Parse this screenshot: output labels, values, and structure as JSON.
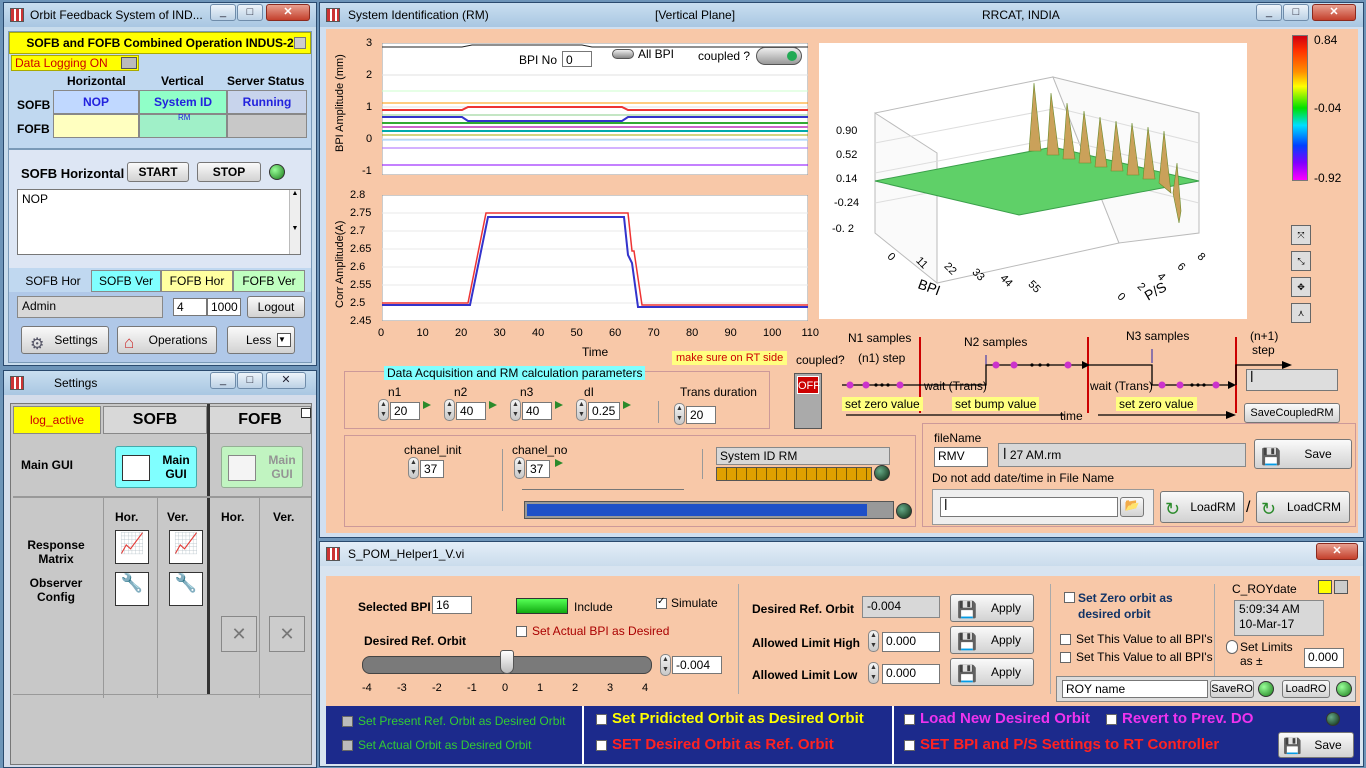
{
  "win1": {
    "title": "Orbit Feedback System of IND...",
    "header": "SOFB and FOFB Combined Operation INDUS-2",
    "data_logging": "Data Logging ON",
    "col_horizontal": "Horizontal",
    "col_vertical": "Vertical",
    "col_server": "Server Status",
    "row_sofb": "SOFB",
    "row_fofb": "FOFB",
    "sofb_h": "NOP",
    "sofb_v": "System ID",
    "sofb_v_sub": "RM",
    "sofb_status": "Running",
    "sofb_horizontal_label": "SOFB Horizontal",
    "start": "START",
    "stop": "STOP",
    "textbox": "NOP",
    "tabs": [
      "SOFB Hor",
      "SOFB Ver",
      "FOFB Hor",
      "FOFB Ver"
    ],
    "user": "Admin",
    "num1": "4",
    "num2": "1000",
    "logout": "Logout",
    "settings": "Settings",
    "operations": "Operations",
    "less": "Less"
  },
  "win2": {
    "title": "Settings",
    "log_active": "log_active",
    "sofb": "SOFB",
    "fofb": "FOFB",
    "main_gui_row": "Main GUI",
    "main_gui": "Main GUI",
    "hor": "Hor.",
    "ver": "Ver.",
    "resp": "Response Matrix",
    "obs": "Observer Config"
  },
  "win3": {
    "title": "System Identification (RM)",
    "subtitle": "[Vertical Plane]",
    "org": "RRCAT, INDIA",
    "bpi_no_label": "BPI No",
    "bpi_no": "0",
    "all_bpi": "All BPI",
    "coupled_q": "coupled ?",
    "chart1": {
      "ylabel": "BPI Amplitude (mm)",
      "yticks": [
        "3",
        "2",
        "1",
        "0",
        "-1"
      ]
    },
    "chart2": {
      "ylabel": "Corr Amplitude(A)",
      "xlabel": "Time",
      "yticks": [
        "2.8",
        "2.75",
        "2.7",
        "2.65",
        "2.6",
        "2.55",
        "2.5",
        "2.45"
      ],
      "xticks": [
        "0",
        "10",
        "20",
        "30",
        "40",
        "50",
        "60",
        "70",
        "80",
        "90",
        "100",
        "110"
      ]
    },
    "surface": {
      "zticks": [
        "0.90",
        "0.52",
        "0.14",
        "-0.24",
        "-0. 2"
      ],
      "bpi_ticks": [
        "0",
        "11",
        "22",
        "33",
        "44",
        "55"
      ],
      "ps_ticks": [
        "0",
        "2",
        "4",
        "6",
        "8"
      ],
      "bpi": "BPI",
      "ps": "P/S"
    },
    "colorbar": [
      "0.84",
      "-0.04",
      "-0.92"
    ],
    "params": {
      "title": "Data Acquisition and RM calculation parameters",
      "n1": "n1",
      "n2": "n2",
      "n3": "n3",
      "dl": "dI",
      "trans": "Trans duration",
      "n1v": "20",
      "n2v": "40",
      "n3v": "40",
      "dlv": "0.25",
      "transv": "20"
    },
    "rt_note": "make sure on RT side",
    "coupled_q2": "coupled?",
    "off": "OFF",
    "timing": {
      "n1s": "N1 samples",
      "n1step": "(n1) step",
      "n2s": "N2 samples",
      "n3s": "N3 samples",
      "n1p": "(n+1)",
      "step": "step",
      "wait1": "wait (Trans)",
      "wait2": "wait (Trans)",
      "zero1": "set zero value",
      "bump": "set bump value",
      "zero2": "set zero value",
      "time": "time"
    },
    "save_coupled": "SaveCoupledRM",
    "chanel_init": "chanel_init",
    "chanel_init_v": "37",
    "chanel_no": "chanel_no",
    "chanel_no_v": "37",
    "sysid_rm": "System ID RM",
    "filename_label": "fileName",
    "filename": "RMV",
    "filepath": "27 AM.rm",
    "save": "Save",
    "note": "Do not add date/time in File Name",
    "loadrm": "LoadRM",
    "loadcrm": "LoadCRM"
  },
  "win4": {
    "title": "S_POM_Helper1_V.vi",
    "selected_bpi": "Selected BPI",
    "selected_bpi_v": "16",
    "include": "Include",
    "simulate": "Simulate",
    "set_actual_bpi": "Set Actual BPI as Desired",
    "desired_ref_orbit": "Desired Ref. Orbit",
    "slider_value": "-0.004",
    "slider_ticks": [
      "-4",
      "-3",
      "-2",
      "-1",
      "0",
      "1",
      "2",
      "3",
      "4"
    ],
    "desired_ref": "Desired Ref. Orbit",
    "desired_ref_v": "-0.004",
    "limit_high": "Allowed Limit High",
    "limit_high_v": "0.000",
    "limit_low": "Allowed Limit Low",
    "limit_low_v": "0.000",
    "apply": "Apply",
    "set_zero": "Set Zero orbit as desired orbit",
    "set_all1": "Set This Value to all BPI's",
    "set_all2": "Set This Value to all BPI's",
    "c_roydate": "C_ROYdate",
    "time": "5:09:34 AM",
    "date": "10-Mar-17",
    "set_limits": "Set Limits as ±",
    "set_limits_v": "0.000",
    "roy_name": "ROY name",
    "savero": "SaveRO",
    "loadro": "LoadRO",
    "b1": "Set Present Ref. Orbit as Desired Orbit",
    "b2": "Set Actual Orbit as Desired Orbit",
    "b3": "Set Pridicted Orbit as Desired Orbit",
    "b4": "SET Desired Orbit as  Ref. Orbit",
    "b5": "Load New Desired Orbit",
    "b6": "Revert to Prev. DO",
    "b7": "SET BPI and P/S Settings to RT Controller",
    "save": "Save"
  },
  "colors": {
    "panel": "#f8c8a8",
    "accent_yellow": "#ffff00",
    "cyan_tab": "#80ffff",
    "green_tab": "#c0ffc0",
    "bottom_bar": "#1c2a8c"
  }
}
